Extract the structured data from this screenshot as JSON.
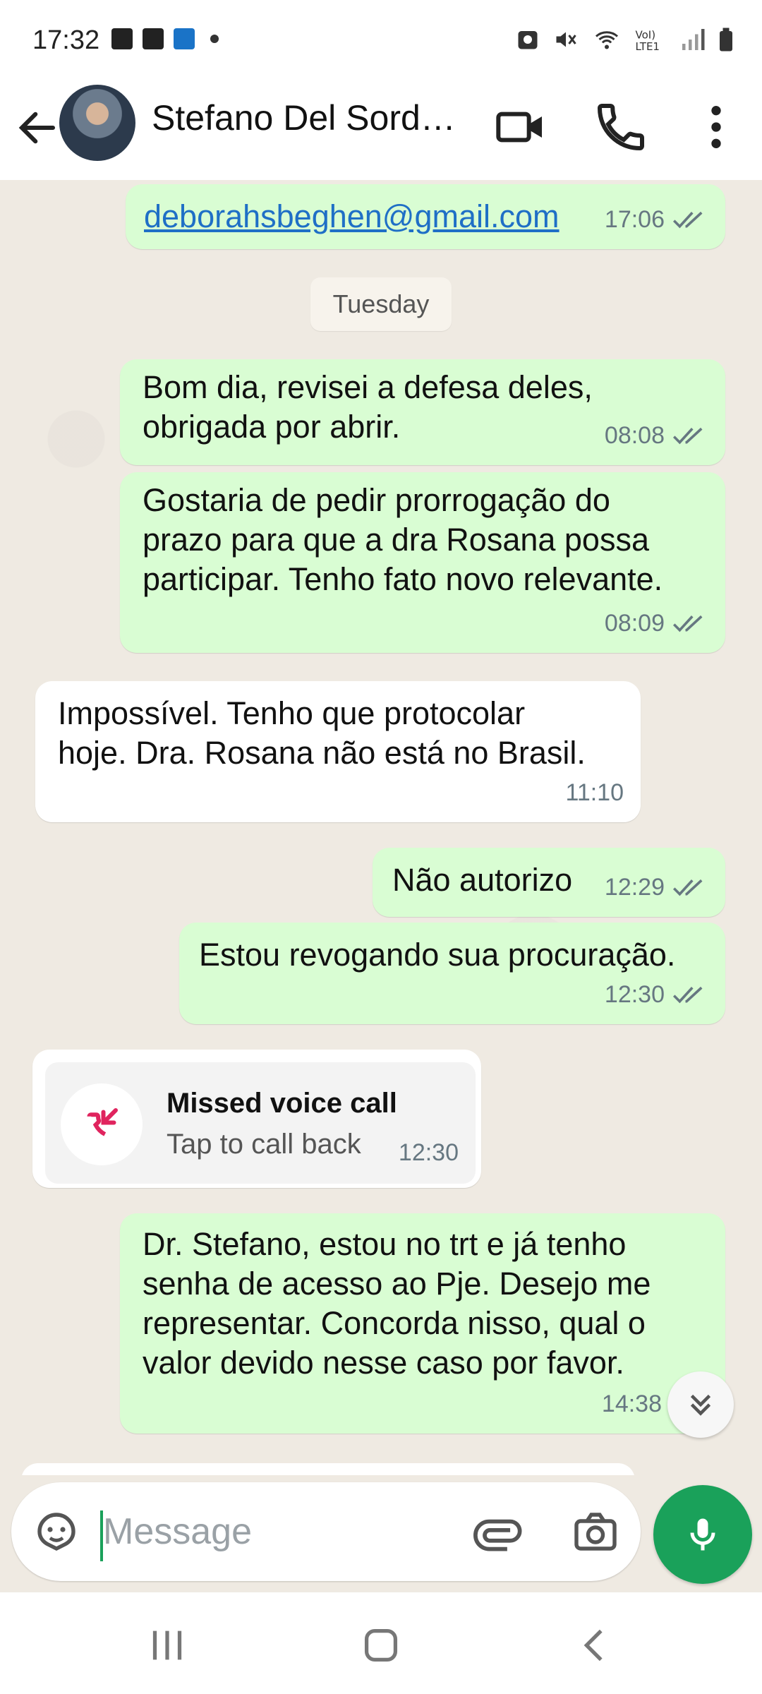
{
  "status_bar": {
    "time": "17:32"
  },
  "header": {
    "contact_name": "Stefano Del Sordo..."
  },
  "chat": {
    "date_chip": "Tuesday",
    "messages": [
      {
        "direction": "out",
        "text": "deborahsbeghen@gmail.com",
        "time": "17:06",
        "is_link": true
      },
      {
        "direction": "out",
        "text": "Bom dia, revisei a defesa deles,\nobrigada por abrir.",
        "time": "08:08"
      },
      {
        "direction": "out",
        "text": "Gostaria de pedir prorrogação do\nprazo para que a dra Rosana possa\nparticipar. Tenho fato novo relevante.",
        "time": "08:09"
      },
      {
        "direction": "in",
        "text": "Impossível. Tenho que protocolar\nhoje. Dra. Rosana não está no Brasil.",
        "time": "11:10"
      },
      {
        "direction": "out",
        "text": "Não autorizo",
        "time": "12:29"
      },
      {
        "direction": "out",
        "text": "Estou revogando sua procuração.",
        "time": "12:30"
      },
      {
        "direction": "out",
        "text": "Dr. Stefano, estou no trt e já tenho\nsenha de acesso ao Pje. Desejo me\nrepresentar. Concorda nisso, qual o\nvalor devido nesse caso por favor.",
        "time": "14:38"
      }
    ],
    "missed_call": {
      "title": "Missed voice call",
      "subtitle": "Tap to call back",
      "time": "12:30"
    }
  },
  "input": {
    "placeholder": "Message"
  },
  "colors": {
    "outgoing_bubble": "#d9fdd3",
    "incoming_bubble": "#ffffff",
    "accent": "#1aa15a",
    "missed_call": "#e0245e",
    "chat_bg": "#efeae2"
  }
}
